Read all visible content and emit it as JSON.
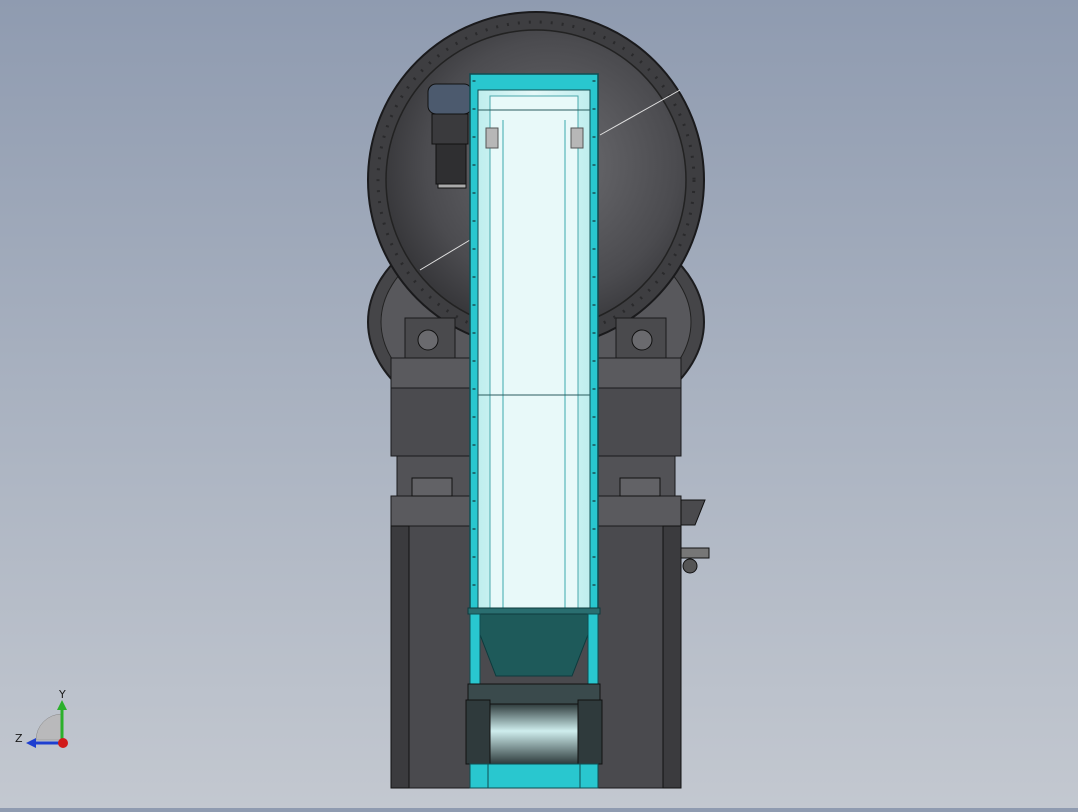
{
  "viewer": {
    "background_top": "#8f9bb0",
    "background_bottom": "#c3c8d0"
  },
  "model": {
    "accent_cyan": "#29c7cf",
    "glass_color": "#dff6f6",
    "hopper_color": "#1e5a5a",
    "machine_dark": "#3d3d3f",
    "machine_mid": "#5e5e62",
    "machine_light": "#8a8a8e"
  },
  "triad": {
    "y_label": "Y",
    "z_label": "Z",
    "y_color": "#2bb02b",
    "z_color": "#1e3fd0",
    "origin_color": "#d11a1a"
  }
}
